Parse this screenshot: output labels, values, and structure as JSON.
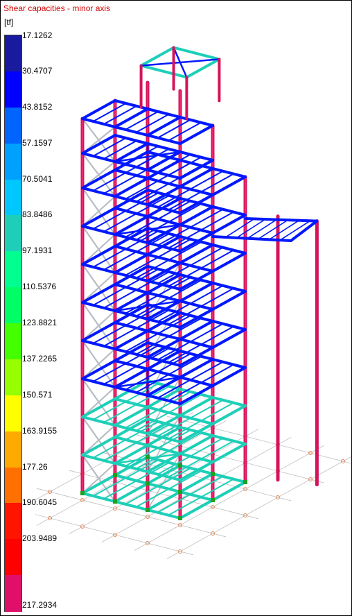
{
  "view": {
    "title": "Shear capacities - minor axis",
    "unit": "[tf]"
  },
  "legend": {
    "ticks": [
      "17.1262",
      "30.4707",
      "43.8152",
      "57.1597",
      "70.5041",
      "83.8486",
      "97.1931",
      "110.5376",
      "123.8821",
      "137.2265",
      "150.571",
      "163.9155",
      "177.26",
      "190.6045",
      "203.9489",
      "217.2934"
    ],
    "colors": [
      "#1a1a9e",
      "#0000ff",
      "#0064ff",
      "#00a0ff",
      "#00c8ff",
      "#1ecfb8",
      "#00ff90",
      "#00ff64",
      "#44ff00",
      "#96ff00",
      "#ffff00",
      "#ffaa00",
      "#ff7000",
      "#ff1400",
      "#ff0000",
      "#e0106a"
    ]
  },
  "members": {
    "column_color": "#d4145a",
    "beam_upper_color": "#0018ff",
    "beam_lower_color": "#1ecfb8",
    "brace_color": "#b8bcc4",
    "label_color": "#ff3a8a",
    "grid_color": "#c0c0c0",
    "support_color": "#e98a5a",
    "node_color": "#20a020"
  }
}
